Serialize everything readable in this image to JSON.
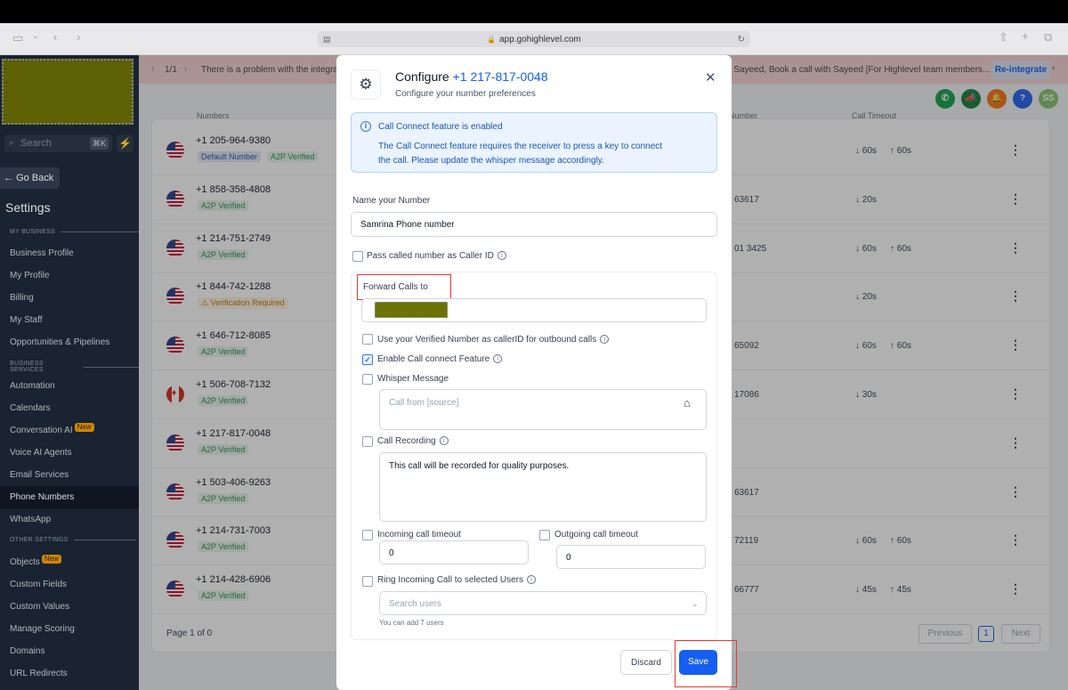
{
  "browser": {
    "url": "app.gohighlevel.com"
  },
  "sidebar": {
    "search_placeholder": "Search",
    "search_shortcut": "⌘K",
    "go_back": "Go Back",
    "settings_title": "Settings",
    "sections": {
      "my_business": "MY BUSINESS",
      "business_services": "BUSINESS SERVICES",
      "other_settings": "OTHER SETTINGS"
    },
    "items_a": [
      "Business Profile",
      "My Profile",
      "Billing",
      "My Staff",
      "Opportunities & Pipelines"
    ],
    "items_b": [
      "Automation",
      "Calendars",
      "Conversation AI",
      "Voice AI Agents",
      "Email Services",
      "Phone Numbers",
      "WhatsApp"
    ],
    "items_c": [
      "Objects",
      "Custom Fields",
      "Custom Values",
      "Manage Scoring",
      "Domains",
      "URL Redirects"
    ],
    "new_badge": "New"
  },
  "banner": {
    "counter": "1/1",
    "message_left": "There is a problem with the integrat",
    "message_right": "d Sayeed, Book a call with Sayeed [For Highlevel team members...",
    "reintegrate": "Re-integrate"
  },
  "header_icons": {
    "avatar_initials": "SS",
    "help": "?"
  },
  "table": {
    "col_numbers": "Numbers",
    "col_forward": "Number",
    "col_timeout": "Call Timeout",
    "rows": [
      {
        "flag": "us",
        "number": "+1 205-964-9380",
        "badges": [
          "Default Number",
          "A2P Verified"
        ],
        "forward": "",
        "in": "↓ 60s",
        "out": "↑ 60s"
      },
      {
        "flag": "us",
        "number": "+1 858-358-4808",
        "badges": [
          "A2P Verified"
        ],
        "forward": "63617",
        "in": "↓ 20s",
        "out": ""
      },
      {
        "flag": "us",
        "number": "+1 214-751-2749",
        "badges": [
          "A2P Verified"
        ],
        "forward": "01 3425",
        "in": "↓ 60s",
        "out": "↑ 60s"
      },
      {
        "flag": "us",
        "number": "+1 844-742-1288",
        "badges": [
          "⚠ Verification Required"
        ],
        "forward": "",
        "in": "↓ 20s",
        "out": ""
      },
      {
        "flag": "us",
        "number": "+1 646-712-8085",
        "badges": [
          "A2P Verified"
        ],
        "forward": "65092",
        "in": "↓ 60s",
        "out": "↑ 60s"
      },
      {
        "flag": "ca",
        "number": "+1 506-708-7132",
        "badges": [
          "A2P Verified"
        ],
        "forward": "17086",
        "in": "↓ 30s",
        "out": ""
      },
      {
        "flag": "us",
        "number": "+1 217-817-0048",
        "badges": [
          "A2P Verified"
        ],
        "forward": "",
        "in": "",
        "out": ""
      },
      {
        "flag": "us",
        "number": "+1 503-406-9263",
        "badges": [
          "A2P Verified"
        ],
        "forward": "63617",
        "in": "",
        "out": ""
      },
      {
        "flag": "us",
        "number": "+1 214-731-7003",
        "badges": [
          "A2P Verified"
        ],
        "forward": "72119",
        "in": "↓ 60s",
        "out": "↑ 60s"
      },
      {
        "flag": "us",
        "number": "+1 214-428-6906",
        "badges": [
          "A2P Verified"
        ],
        "forward": "66777",
        "in": "↓ 45s",
        "out": "↑ 45s"
      }
    ],
    "page_info": "Page 1 of 0",
    "prev": "Previous",
    "page": "1",
    "next": "Next"
  },
  "modal": {
    "title": "Configure",
    "title_number": "+1 217-817-0048",
    "subtitle": "Configure your number preferences",
    "info_title": "Call Connect feature is enabled",
    "info_text": "The Call Connect feature requires the receiver to press a key to connect the call. Please update the whisper message accordingly.",
    "name_label": "Name your Number",
    "name_value": "Samrina Phone number",
    "pass_caller_id": "Pass called number as Caller ID",
    "forward_label": "Forward Calls to",
    "use_verified": "Use your Verified Number as callerID for outbound calls",
    "enable_call_connect": "Enable Call connect Feature",
    "whisper_label": "Whisper Message",
    "whisper_placeholder": "Call from [source]",
    "recording_label": "Call Recording",
    "recording_value": "This call will be recorded for quality purposes.",
    "incoming_label": "Incoming call timeout",
    "incoming_value": "0",
    "outgoing_label": "Outgoing call timeout",
    "outgoing_value": "0",
    "ring_label": "Ring Incoming Call to selected Users",
    "users_placeholder": "Search users",
    "users_hint": "You can add 7 users",
    "discard": "Discard",
    "save": "Save"
  }
}
